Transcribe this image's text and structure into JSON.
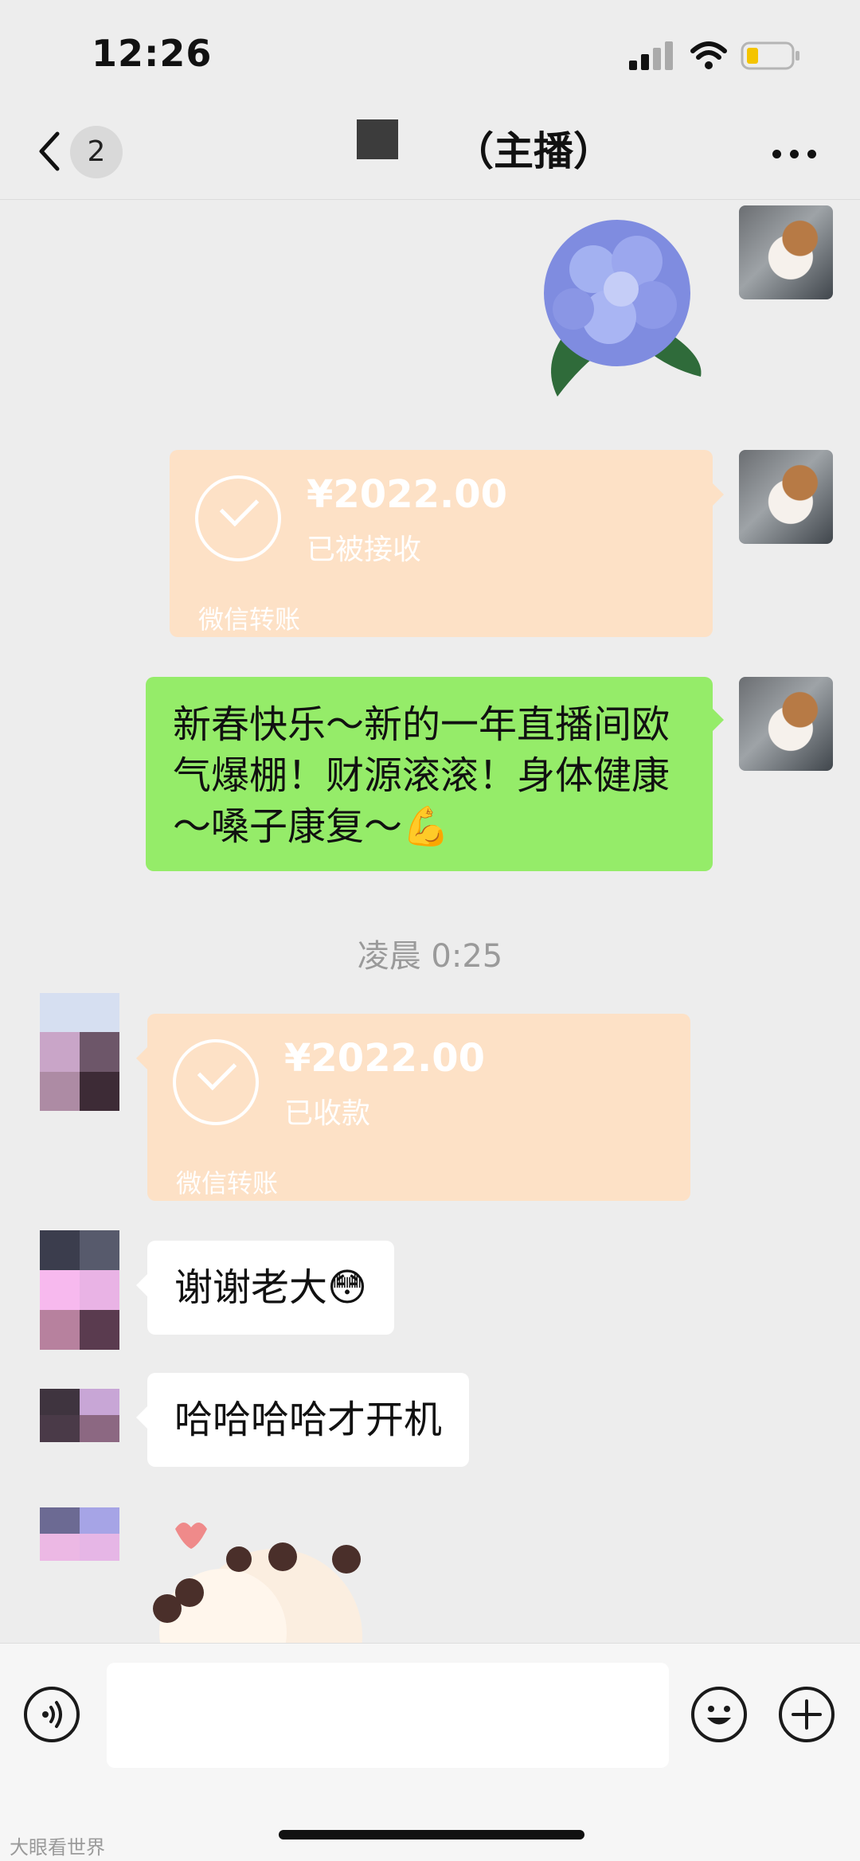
{
  "status_bar": {
    "time": "12:26"
  },
  "nav": {
    "back_badge": "2",
    "title": "（主播）"
  },
  "messages": {
    "transfer_sent": {
      "amount": "¥2022.00",
      "status": "已被接收",
      "source": "微信转账"
    },
    "green_text": "新春快乐～新的一年直播间欧气爆棚！财源滚滚！身体健康～嗓子康复～💪",
    "timestamp": "凌晨 0:25",
    "transfer_received": {
      "amount": "¥2022.00",
      "status": "已收款",
      "source": "微信转账"
    },
    "text_1": "谢谢老大😳",
    "text_2": "哈哈哈哈才开机"
  },
  "watermark": "大眼看世界",
  "icons": {
    "back": "chevron-left-icon",
    "more": "more-icon",
    "voice": "voice-icon",
    "emoji": "emoji-icon",
    "plus": "plus-icon"
  },
  "colors": {
    "background": "#ededed",
    "sent_bubble": "#95ec69",
    "received_bubble": "#ffffff",
    "transfer_card": "#fde1c6"
  }
}
